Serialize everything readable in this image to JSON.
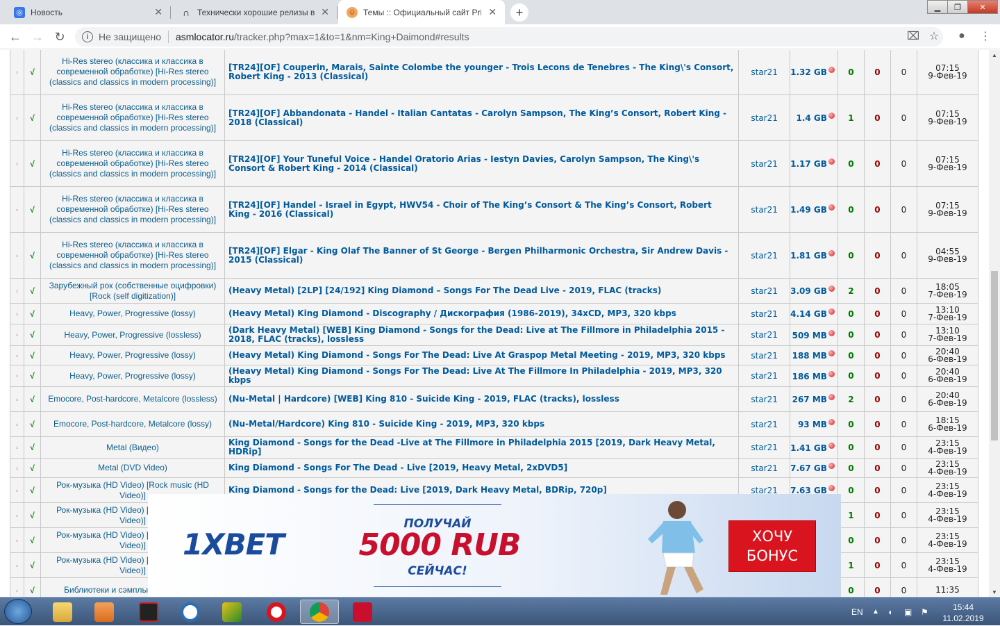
{
  "browser": {
    "tabs": [
      {
        "title": "Новость",
        "favicon": "gear-icon",
        "active": false
      },
      {
        "title": "Технически хорошие релизы в",
        "favicon": "headphones-icon",
        "active": false
      },
      {
        "title": "Темы :: Официальный сайт Priva",
        "favicon": "avatar-icon",
        "active": true
      }
    ],
    "new_tab": "+",
    "security": "Не защищено",
    "url_host": "asmlocator.ru",
    "url_path": "/tracker.php?max=1&to=1&nm=King+Daimond#results"
  },
  "results": [
    {
      "forum": "Hi-Res stereo (классика и классика в современной обработке) [Hi-Res stereo (classics and classics in modern processing)]",
      "title": "[TR24][OF] Couperin, Marais, Sainte Colombe the younger - Trois Lecons de Tenebres - The King\\'s Consort, Robert King - 2013 (Classical)",
      "author": "star21",
      "size": "1.32 GB",
      "seeds": "0",
      "leechers": "0",
      "downloads": "0",
      "time": "07:15",
      "date": "9-Фев-19"
    },
    {
      "forum": "Hi-Res stereo (классика и классика в современной обработке) [Hi-Res stereo (classics and classics in modern processing)]",
      "title": "[TR24][OF] Abbandonata - Handel - Italian Cantatas - Carolyn Sampson, The King’s Consort, Robert King - 2018 (Classical)",
      "author": "star21",
      "size": "1.4 GB",
      "seeds": "1",
      "leechers": "0",
      "downloads": "0",
      "time": "07:15",
      "date": "9-Фев-19"
    },
    {
      "forum": "Hi-Res stereo (классика и классика в современной обработке) [Hi-Res stereo (classics and classics in modern processing)]",
      "title": "[TR24][OF] Your Tuneful Voice - Handel Oratorio Arias - Iestyn Davies, Carolyn Sampson, The King\\'s Consort & Robert King - 2014 (Classical)",
      "author": "star21",
      "size": "1.17 GB",
      "seeds": "0",
      "leechers": "0",
      "downloads": "0",
      "time": "07:15",
      "date": "9-Фев-19"
    },
    {
      "forum": "Hi-Res stereo (классика и классика в современной обработке) [Hi-Res stereo (classics and classics in modern processing)]",
      "title": "[TR24][OF] Handel - Israel in Egypt, HWV54 - Choir of The King’s Consort & The King’s Consort, Robert King - 2016 (Classical)",
      "author": "star21",
      "size": "1.49 GB",
      "seeds": "0",
      "leechers": "0",
      "downloads": "0",
      "time": "07:15",
      "date": "9-Фев-19"
    },
    {
      "forum": "Hi-Res stereo (классика и классика в современной обработке) [Hi-Res stereo (classics and classics in modern processing)]",
      "title": "[TR24][OF] Elgar - King Olaf The Banner of St George - Bergen Philharmonic Orchestra, Sir Andrew Davis - 2015 (Classical)",
      "author": "star21",
      "size": "1.81 GB",
      "seeds": "0",
      "leechers": "0",
      "downloads": "0",
      "time": "04:55",
      "date": "9-Фев-19"
    },
    {
      "forum": "Зарубежный рок (собственные оцифровки) [Rock (self digitization)]",
      "title": "(Heavy Metal) [2LP] [24/192] King Diamond – Songs For The Dead Live - 2019, FLAC (tracks)",
      "author": "star21",
      "size": "3.09 GB",
      "seeds": "2",
      "leechers": "0",
      "downloads": "0",
      "time": "18:05",
      "date": "7-Фев-19"
    },
    {
      "forum": "Heavy, Power, Progressive (lossy)",
      "title": "(Heavy Metal) King Diamond - Discography / Дискография (1986-2019), 34xCD, MP3, 320 kbps",
      "author": "star21",
      "size": "4.14 GB",
      "seeds": "0",
      "leechers": "0",
      "downloads": "0",
      "time": "13:10",
      "date": "7-Фев-19"
    },
    {
      "forum": "Heavy, Power, Progressive (lossless)",
      "title": "(Dark Heavy Metal) [WEB] King Diamond - Songs for the Dead: Live at The Fillmore in Philadelphia 2015 - 2018, FLAC (tracks), lossless",
      "author": "star21",
      "size": "509 MB",
      "seeds": "0",
      "leechers": "0",
      "downloads": "0",
      "time": "13:10",
      "date": "7-Фев-19"
    },
    {
      "forum": "Heavy, Power, Progressive (lossy)",
      "title": "(Heavy Metal) King Diamond - Songs For The Dead: Live At Graspop Metal Meeting - 2019, MP3, 320 kbps",
      "author": "star21",
      "size": "188 MB",
      "seeds": "0",
      "leechers": "0",
      "downloads": "0",
      "time": "20:40",
      "date": "6-Фев-19"
    },
    {
      "forum": "Heavy, Power, Progressive (lossy)",
      "title": "(Heavy Metal) King Diamond - Songs For The Dead: Live At The Fillmore In Philadelphia - 2019, MP3, 320 kbps",
      "author": "star21",
      "size": "186 MB",
      "seeds": "0",
      "leechers": "0",
      "downloads": "0",
      "time": "20:40",
      "date": "6-Фев-19"
    },
    {
      "forum": "Emocore, Post-hardcore, Metalcore (lossless)",
      "title": "(Nu-Metal | Hardcore) [WEB] King 810 - Suicide King - 2019, FLAC (tracks), lossless",
      "author": "star21",
      "size": "267 MB",
      "seeds": "2",
      "leechers": "0",
      "downloads": "0",
      "time": "20:40",
      "date": "6-Фев-19"
    },
    {
      "forum": "Emocore, Post-hardcore, Metalcore (lossy)",
      "title": "(Nu-Metal/Hardcore) King 810 - Suicide King - 2019, MP3, 320 kbps",
      "author": "star21",
      "size": "93 MB",
      "seeds": "0",
      "leechers": "0",
      "downloads": "0",
      "time": "18:15",
      "date": "6-Фев-19"
    },
    {
      "forum": "Metal (Видео)",
      "title": "King Diamond - Songs for the Dead -Live at The Fillmore in Philadelphia 2015 [2019, Dark Heavy Metal, HDRip]",
      "author": "star21",
      "size": "1.41 GB",
      "seeds": "0",
      "leechers": "0",
      "downloads": "0",
      "time": "23:15",
      "date": "4-Фев-19"
    },
    {
      "forum": "Metal (DVD Video)",
      "title": "King Diamond - Songs For The Dead - Live [2019, Heavy Metal, 2xDVD5]",
      "author": "star21",
      "size": "7.67 GB",
      "seeds": "0",
      "leechers": "0",
      "downloads": "0",
      "time": "23:15",
      "date": "4-Фев-19"
    },
    {
      "forum": "Рок-музыка (HD Video) [Rock music (HD Video)]",
      "title": "King Diamond - Songs for the Dead: Live [2019, Dark Heavy Metal, BDRip, 720p]",
      "author": "star21",
      "size": "7.63 GB",
      "seeds": "0",
      "leechers": "0",
      "downloads": "0",
      "time": "23:15",
      "date": "4-Фев-19"
    },
    {
      "forum": "Рок-музыка (HD Video) [Rock music (HD Video)]",
      "title": "",
      "author": "",
      "size": "",
      "seeds": "1",
      "leechers": "0",
      "downloads": "0",
      "time": "23:15",
      "date": "4-Фев-19"
    },
    {
      "forum": "Рок-музыка (HD Video) [Rock music (HD Video)]",
      "title": "",
      "author": "",
      "size": "",
      "seeds": "0",
      "leechers": "0",
      "downloads": "0",
      "time": "23:15",
      "date": "4-Фев-19"
    },
    {
      "forum": "Рок-музыка (HD Video) [Rock music (HD Video)]",
      "title": "",
      "author": "",
      "size": "",
      "seeds": "1",
      "leechers": "0",
      "downloads": "0",
      "time": "23:15",
      "date": "4-Фев-19"
    },
    {
      "forum": "Библиотеки и сэмплы, пресеты для",
      "title": "",
      "author": "",
      "size": "",
      "seeds": "0",
      "leechers": "0",
      "downloads": "0",
      "time": "11:35",
      "date": ""
    }
  ],
  "check_mark": "√",
  "ad": {
    "brand": "1XBET",
    "headline": "ПОЛУЧАЙ",
    "amount": "5000 RUB",
    "subline": "СЕЙЧАС!",
    "cta_line1": "ХОЧУ",
    "cta_line2": "БОНУС"
  },
  "taskbar": {
    "language": "EN",
    "time": "15:44",
    "date": "11.02.2019"
  },
  "colors": {
    "link": "#005a9c",
    "seeds": "#007700",
    "leech": "#9a0000",
    "ad_red": "#d9141e",
    "ad_blue": "#1a4b9c"
  }
}
